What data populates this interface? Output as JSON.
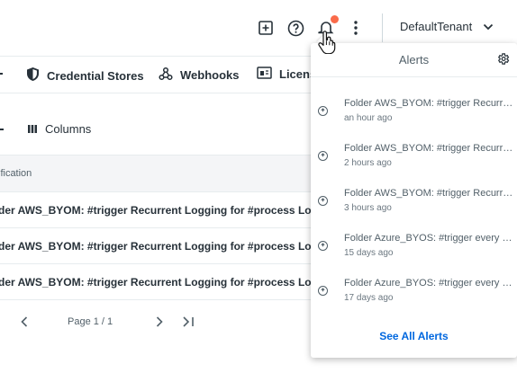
{
  "header": {
    "tenant": "DefaultTenant",
    "icons": [
      "add-box-icon",
      "help-icon",
      "bell-icon",
      "more-vertical-icon",
      "chevron-down-icon"
    ],
    "notification_dot_color": "#fa6b4a"
  },
  "nav": {
    "tabs": [
      {
        "label": "Credential Stores",
        "icon": "shield-icon"
      },
      {
        "label": "Webhooks",
        "icon": "webhook-icon"
      },
      {
        "label": "Licens",
        "icon": "license-icon"
      }
    ]
  },
  "toolbar": {
    "columns_label": "Columns"
  },
  "table": {
    "header": "ification",
    "rows": [
      "der AWS_BYOM: #trigger Recurrent Logging for #process Logg",
      "der AWS_BYOM: #trigger Recurrent Logging for #process Logg",
      "der AWS_BYOM: #trigger Recurrent Logging for #process Logg"
    ]
  },
  "pagination": {
    "label": "Page 1 / 1"
  },
  "alerts": {
    "title": "Alerts",
    "items": [
      {
        "message": "Folder AWS_BYOM: #trigger Recurrent Logging",
        "time": "an hour ago"
      },
      {
        "message": "Folder AWS_BYOM: #trigger Recurrent Logging",
        "time": "2 hours ago"
      },
      {
        "message": "Folder AWS_BYOM: #trigger Recurrent Logging",
        "time": "3 hours ago"
      },
      {
        "message": "Folder Azure_BYOS: #trigger every minute",
        "time": "15 days ago"
      },
      {
        "message": "Folder Azure_BYOS: #trigger every minute",
        "time": "17 days ago"
      }
    ],
    "footer_link": "See All Alerts",
    "link_color": "#0067df"
  }
}
